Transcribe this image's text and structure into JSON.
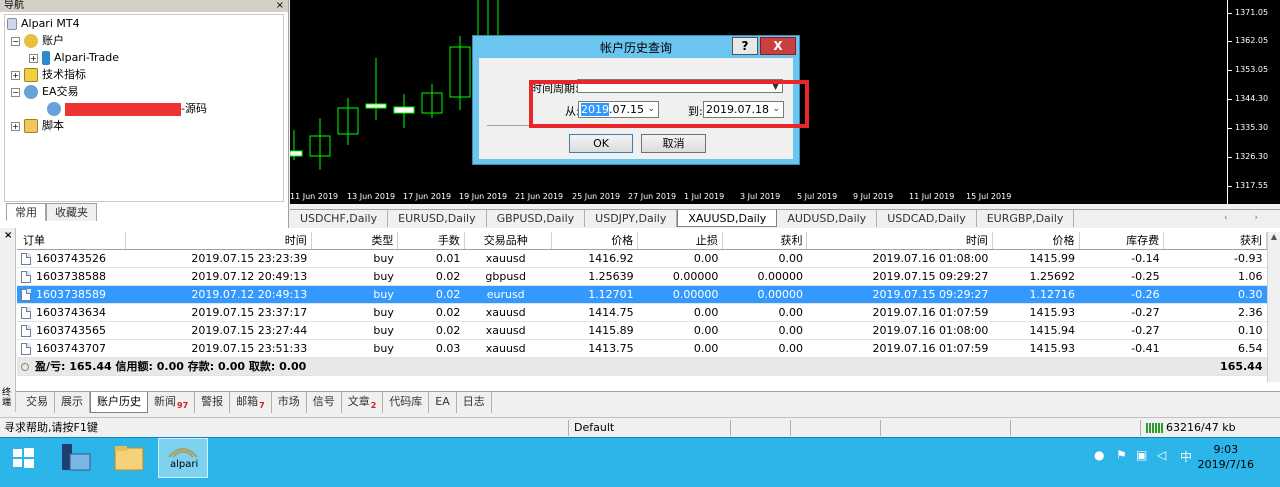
{
  "navigator": {
    "title": "导航",
    "close": "×",
    "items": [
      {
        "label": "Alpari MT4"
      },
      {
        "label": "账户"
      },
      {
        "label": "Alpari-Trade"
      },
      {
        "label": "技术指标"
      },
      {
        "label": "EA交易"
      },
      {
        "label": "-源码"
      },
      {
        "label": "脚本"
      }
    ],
    "tabs": [
      "常用",
      "收藏夹"
    ]
  },
  "chart": {
    "price_labels": [
      "1371.05",
      "1362.05",
      "1353.05",
      "1344.30",
      "1335.30",
      "1326.30",
      "1317.55"
    ],
    "date_labels": [
      "11 Jun 2019",
      "13 Jun 2019",
      "17 Jun 2019",
      "19 Jun 2019",
      "21 Jun 2019",
      "25 Jun 2019",
      "27 Jun 2019",
      "1 Jul 2019",
      "3 Jul 2019",
      "5 Jul 2019",
      "9 Jul 2019",
      "11 Jul 2019",
      "15 Jul 2019"
    ]
  },
  "symbol_tabs": [
    "USDCHF,Daily",
    "EURUSD,Daily",
    "GBPUSD,Daily",
    "USDJPY,Daily",
    "XAUUSD,Daily",
    "AUDUSD,Daily",
    "USDCAD,Daily",
    "EURGBP,Daily"
  ],
  "symbol_tab_arrows": "‹ ›",
  "dialog": {
    "title": "帐户历史查询",
    "help": "?",
    "close": "X",
    "period_label": "时间周期:",
    "from_label": "从:",
    "from_value_hl": "2019",
    "from_value_rest": ".07.15",
    "to_label": "到:",
    "to_value": "2019.07.18",
    "ok": "OK",
    "cancel": "取消"
  },
  "history": {
    "headers": [
      "订单",
      "时间",
      "类型",
      "手数",
      "交易品种",
      "价格",
      "止损",
      "获利",
      "时间",
      "价格",
      "库存费",
      "获利"
    ],
    "rows": [
      [
        "1603743526",
        "2019.07.15 23:23:39",
        "buy",
        "0.01",
        "xauusd",
        "1416.92",
        "0.00",
        "0.00",
        "2019.07.16 01:08:00",
        "1415.99",
        "-0.14",
        "-0.93"
      ],
      [
        "1603738588",
        "2019.07.12 20:49:13",
        "buy",
        "0.02",
        "gbpusd",
        "1.25639",
        "0.00000",
        "0.00000",
        "2019.07.15 09:29:27",
        "1.25692",
        "-0.25",
        "1.06"
      ],
      [
        "1603738589",
        "2019.07.12 20:49:13",
        "buy",
        "0.02",
        "eurusd",
        "1.12701",
        "0.00000",
        "0.00000",
        "2019.07.15 09:29:27",
        "1.12716",
        "-0.26",
        "0.30"
      ],
      [
        "1603743634",
        "2019.07.15 23:37:17",
        "buy",
        "0.02",
        "xauusd",
        "1414.75",
        "0.00",
        "0.00",
        "2019.07.16 01:07:59",
        "1415.93",
        "-0.27",
        "2.36"
      ],
      [
        "1603743565",
        "2019.07.15 23:27:44",
        "buy",
        "0.02",
        "xauusd",
        "1415.89",
        "0.00",
        "0.00",
        "2019.07.16 01:08:00",
        "1415.94",
        "-0.27",
        "0.10"
      ],
      [
        "1603743707",
        "2019.07.15 23:51:33",
        "buy",
        "0.03",
        "xauusd",
        "1413.75",
        "0.00",
        "0.00",
        "2019.07.16 01:07:59",
        "1415.93",
        "-0.41",
        "6.54"
      ]
    ],
    "selected_row": 2,
    "summary": "盈/亏: 165.44 信用额: 0.00 存款: 0.00 取款: 0.00",
    "summary_total": "165.44",
    "side_label": "终端"
  },
  "terminal_tabs": [
    {
      "label": "交易",
      "badge": ""
    },
    {
      "label": "展示",
      "badge": ""
    },
    {
      "label": "账户历史",
      "badge": ""
    },
    {
      "label": "新闻",
      "badge": "97"
    },
    {
      "label": "警报",
      "badge": ""
    },
    {
      "label": "邮箱",
      "badge": "7"
    },
    {
      "label": "市场",
      "badge": ""
    },
    {
      "label": "信号",
      "badge": ""
    },
    {
      "label": "文章",
      "badge": "2"
    },
    {
      "label": "代码库",
      "badge": ""
    },
    {
      "label": "EA",
      "badge": ""
    },
    {
      "label": "日志",
      "badge": ""
    }
  ],
  "status": {
    "help": "寻求帮助,请按F1键",
    "profile": "Default",
    "traffic": "63216/47 kb"
  },
  "taskbar": {
    "app_label": "alpari",
    "ime": "中",
    "time": "9:03",
    "date": "2019/7/16"
  },
  "colors": {
    "selection": "#3399ff",
    "highlight_box": "#e8262c",
    "candle_up": "#00ff00",
    "taskbar": "#2bb5e8"
  }
}
